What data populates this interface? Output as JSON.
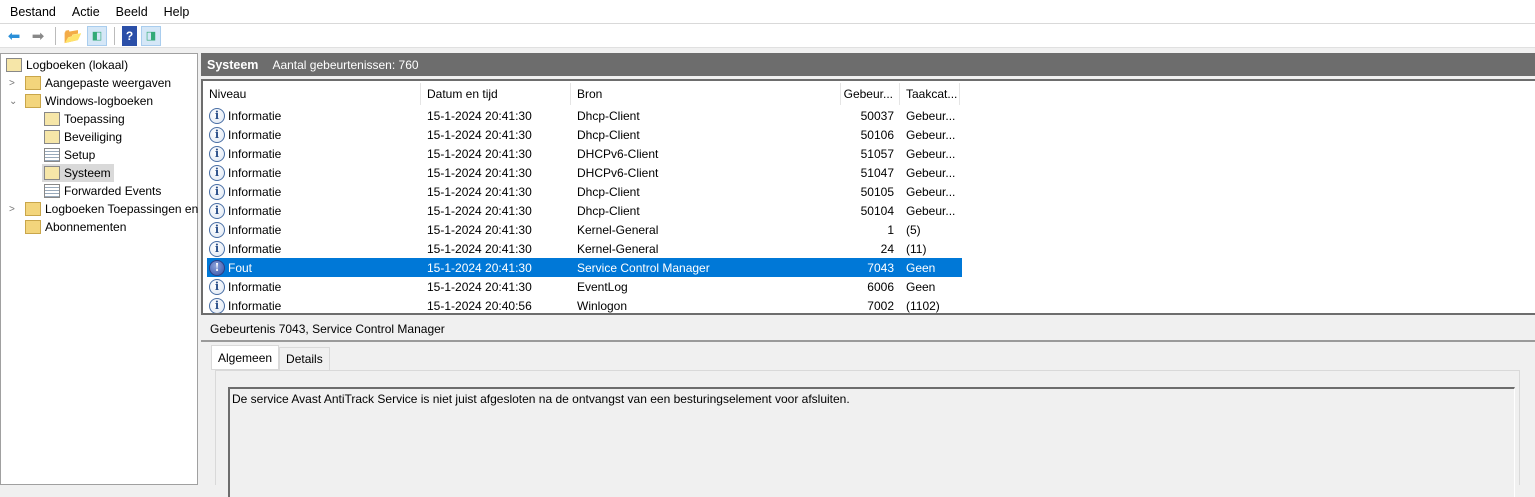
{
  "menu": [
    "Bestand",
    "Actie",
    "Beeld",
    "Help"
  ],
  "tree": {
    "root": "Logboeken (lokaal)",
    "custom_views": "Aangepaste weergaven",
    "windows_logs": "Windows-logboeken",
    "children": [
      "Toepassing",
      "Beveiliging",
      "Setup",
      "Systeem",
      "Forwarded Events"
    ],
    "app_logs": "Logboeken Toepassingen en",
    "subscriptions": "Abonnementen"
  },
  "header": {
    "title": "Systeem",
    "count": "Aantal gebeurtenissen: 760"
  },
  "columns": [
    "Niveau",
    "Datum en tijd",
    "Bron",
    "Gebeur...",
    "Taakcat..."
  ],
  "rows": [
    {
      "level": "Informatie",
      "date": "15-1-2024 20:41:30",
      "source": "Dhcp-Client",
      "id": "50037",
      "task": "Gebeur..."
    },
    {
      "level": "Informatie",
      "date": "15-1-2024 20:41:30",
      "source": "Dhcp-Client",
      "id": "50106",
      "task": "Gebeur..."
    },
    {
      "level": "Informatie",
      "date": "15-1-2024 20:41:30",
      "source": "DHCPv6-Client",
      "id": "51057",
      "task": "Gebeur..."
    },
    {
      "level": "Informatie",
      "date": "15-1-2024 20:41:30",
      "source": "DHCPv6-Client",
      "id": "51047",
      "task": "Gebeur..."
    },
    {
      "level": "Informatie",
      "date": "15-1-2024 20:41:30",
      "source": "Dhcp-Client",
      "id": "50105",
      "task": "Gebeur..."
    },
    {
      "level": "Informatie",
      "date": "15-1-2024 20:41:30",
      "source": "Dhcp-Client",
      "id": "50104",
      "task": "Gebeur..."
    },
    {
      "level": "Informatie",
      "date": "15-1-2024 20:41:30",
      "source": "Kernel-General",
      "id": "1",
      "task": "(5)"
    },
    {
      "level": "Informatie",
      "date": "15-1-2024 20:41:30",
      "source": "Kernel-General",
      "id": "24",
      "task": "(11)"
    },
    {
      "level": "Fout",
      "date": "15-1-2024 20:41:30",
      "source": "Service Control Manager",
      "id": "7043",
      "task": "Geen"
    },
    {
      "level": "Informatie",
      "date": "15-1-2024 20:41:30",
      "source": "EventLog",
      "id": "6006",
      "task": "Geen"
    },
    {
      "level": "Informatie",
      "date": "15-1-2024 20:40:56",
      "source": "Winlogon",
      "id": "7002",
      "task": "(1102)"
    }
  ],
  "detail": {
    "title": "Gebeurtenis 7043, Service Control Manager",
    "tabs": [
      "Algemeen",
      "Details"
    ],
    "message": "De service Avast AntiTrack Service is niet juist afgesloten na de ontvangst van een besturingselement voor afsluiten."
  },
  "colors": {
    "selection": "#0078d7",
    "header": "#6d6d6d"
  }
}
